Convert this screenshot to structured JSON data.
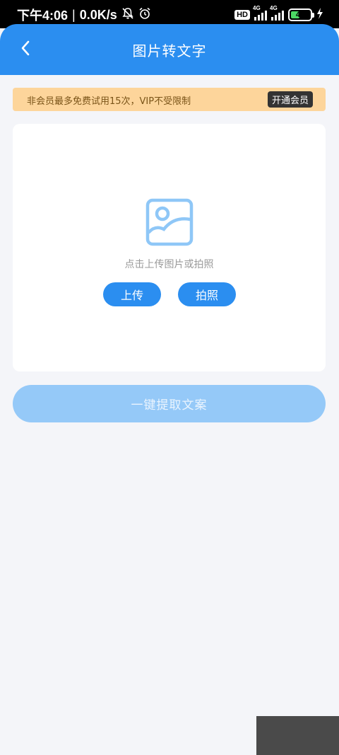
{
  "status_bar": {
    "time": "下午4:06",
    "speed": "0.0K/s",
    "hd_label": "HD",
    "network_label_1": "4G",
    "network_label_2": "4G",
    "battery_level": "41"
  },
  "header": {
    "title": "图片转文字",
    "back_icon": "chevron-left-icon"
  },
  "notice": {
    "text": "非会员最多免费试用15次，VIP不受限制",
    "vip_button": "开通会员"
  },
  "upload": {
    "icon": "image-icon",
    "hint": "点击上传图片或拍照",
    "upload_button": "上传",
    "photo_button": "拍照"
  },
  "actions": {
    "extract_button": "一键提取文案"
  },
  "colors": {
    "primary": "#2b8ef0",
    "disabled_button": "#95c9f8",
    "notice_bg": "#fdd59b",
    "notice_text": "#7a5418",
    "background": "#f4f5f9"
  }
}
